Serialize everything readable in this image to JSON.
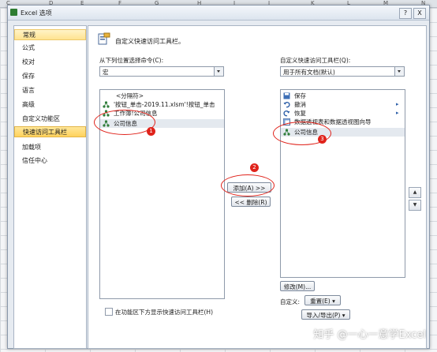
{
  "sheet": {
    "columns": [
      "C",
      "D",
      "E",
      "F",
      "G",
      "H",
      "I",
      "J",
      "K",
      "L",
      "M",
      "N"
    ]
  },
  "dialog": {
    "title": "Excel 选项",
    "help_label": "?",
    "close_label": "X"
  },
  "nav": {
    "items": [
      {
        "label": "常规",
        "selected": true
      },
      {
        "label": "公式",
        "selected": false
      },
      {
        "label": "校对",
        "selected": false
      },
      {
        "label": "保存",
        "selected": false
      },
      {
        "label": "语言",
        "selected": false
      },
      {
        "label": "高级",
        "selected": false
      },
      {
        "label": "自定义功能区",
        "selected": false
      },
      {
        "label": "快速访问工具栏",
        "selected": true
      },
      {
        "label": "加载项",
        "selected": false
      },
      {
        "label": "信任中心",
        "selected": false
      }
    ]
  },
  "panel": {
    "header": "自定义快速访问工具栏。",
    "left": {
      "choose_label": "从下列位置选择命令(C):",
      "choose_value": "宏",
      "items": [
        {
          "label": "<分隔符>",
          "icon": "none"
        },
        {
          "label": "'按钮_单击-2019.11.xlsm'!按钮_单击",
          "icon": "macro-icon"
        },
        {
          "label": "工作簿!公司信息",
          "icon": "macro-icon"
        },
        {
          "label": "公司信息",
          "icon": "macro-icon"
        }
      ]
    },
    "right": {
      "customize_label": "自定义快速访问工具栏(Q):",
      "customize_value": "用于所有文档(默认)",
      "items": [
        {
          "label": "保存",
          "icon": "save-icon"
        },
        {
          "label": "撤消",
          "icon": "undo-icon"
        },
        {
          "label": "恢复",
          "icon": "redo-icon"
        },
        {
          "label": "数据透视表和数据透视图向导",
          "icon": "pivot-icon"
        },
        {
          "label": "公司信息",
          "icon": "macro-icon"
        }
      ],
      "modify_button": "修改(M)...",
      "customize_prefix": "自定义:",
      "reset_button": "重置(E) ▾",
      "import_export_button": "导入/导出(P) ▾"
    },
    "add_button": "添加(A) >>",
    "remove_button": "<< 删除(R)",
    "show_below_ribbon": "在功能区下方显示快速访问工具栏(H)",
    "up_label": "▲",
    "down_label": "▼"
  },
  "annotations": [
    {
      "number": "1"
    },
    {
      "number": "2"
    },
    {
      "number": "3"
    }
  ],
  "watermark": "知乎 @一心一意学Excel",
  "colors": {
    "annotation_red": "#e0231b",
    "nav_selected": "#ffd25c"
  }
}
